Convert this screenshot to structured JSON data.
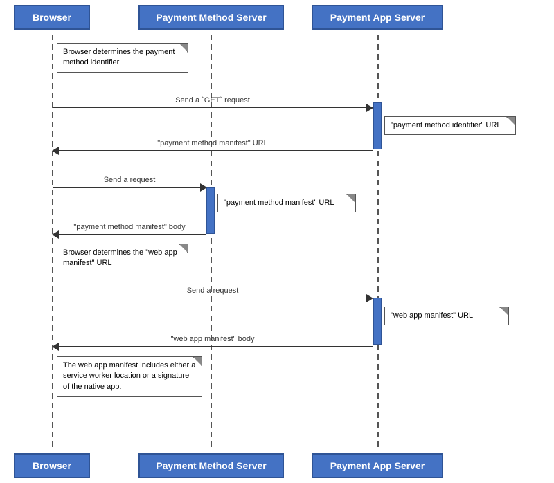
{
  "actors": {
    "browser": "Browser",
    "pms": "Payment Method Server",
    "pas": "Payment App Server"
  },
  "notes": {
    "note1": "Browser determines\nthe payment method identifier",
    "note2": "\"payment method identifier\" URL",
    "note3": "\"payment method manifest\" URL",
    "note4": "\"payment method manifest\" body",
    "note5": "Browser determines\nthe \"web app manifest\" URL",
    "note6": "\"web app manifest\" URL",
    "note7": "\"web app manifest\" body",
    "note8": "The web app manifest includes\neither a service worker location or\na signature of the native app."
  },
  "arrows": {
    "a1_label": "Send a `GET` request",
    "a2_label": "\"payment method manifest\" URL",
    "a3_label": "Send a request",
    "a4_label": "\"payment method manifest\" body",
    "a5_label": "Send a request",
    "a6_label": "\"web app manifest\" body"
  }
}
